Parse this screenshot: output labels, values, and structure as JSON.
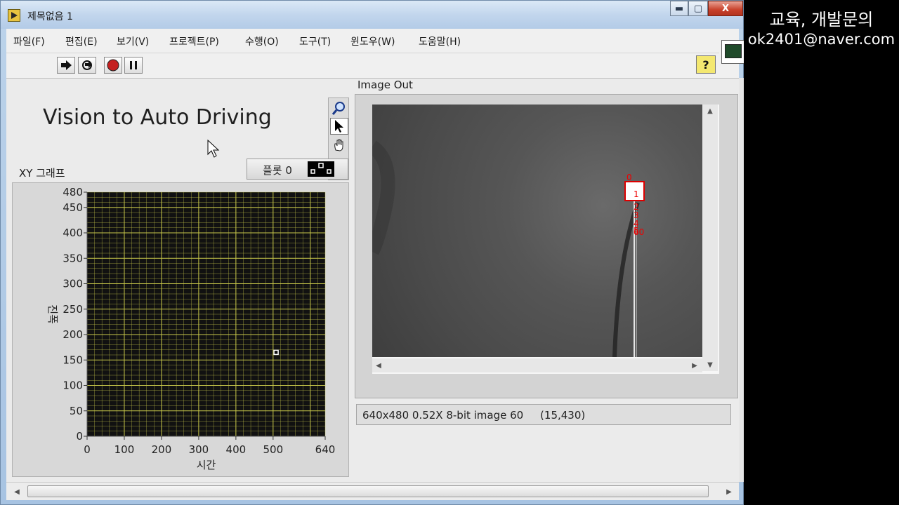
{
  "window": {
    "title": "제목없음 1",
    "controls": {
      "minimize": "▬",
      "maximize": "▢",
      "close": "X"
    }
  },
  "menu": [
    "파일(F)",
    "편집(E)",
    "보기(V)",
    "프로젝트(P)",
    "수행(O)",
    "도구(T)",
    "윈도우(W)",
    "도움말(H)"
  ],
  "toolbar": {
    "buttons": [
      "run-arrow-icon",
      "run-continuously-icon",
      "abort-icon",
      "pause-icon"
    ],
    "help_label": "?"
  },
  "panel": {
    "title": "Vision to Auto Driving"
  },
  "graph": {
    "label": "XY 그래프",
    "legend_label": "플롯 0",
    "colors": {
      "plot_bg": "#111111",
      "grid": "#c8c84a",
      "point": "#ffffff"
    }
  },
  "image": {
    "label": "Image Out",
    "marker_labels": [
      "0",
      "1",
      "2",
      "3",
      "4",
      "5",
      "60"
    ],
    "status": "640x480 0.52X 8-bit image 60     (15,430)"
  },
  "overlay": {
    "line1": "교육, 개발문의",
    "line2": "ok2401@naver.com"
  },
  "chart_data": {
    "type": "scatter",
    "title": "",
    "xlabel": "시간",
    "ylabel": "진폭",
    "xlim": [
      0,
      640
    ],
    "ylim": [
      0,
      480
    ],
    "x_ticks": [
      0,
      100,
      200,
      300,
      400,
      500,
      640
    ],
    "y_ticks": [
      0,
      50,
      100,
      150,
      200,
      250,
      300,
      350,
      400,
      450,
      480
    ],
    "series": [
      {
        "name": "플롯 0",
        "points": [
          {
            "x": 508,
            "y": 165
          }
        ]
      }
    ]
  }
}
